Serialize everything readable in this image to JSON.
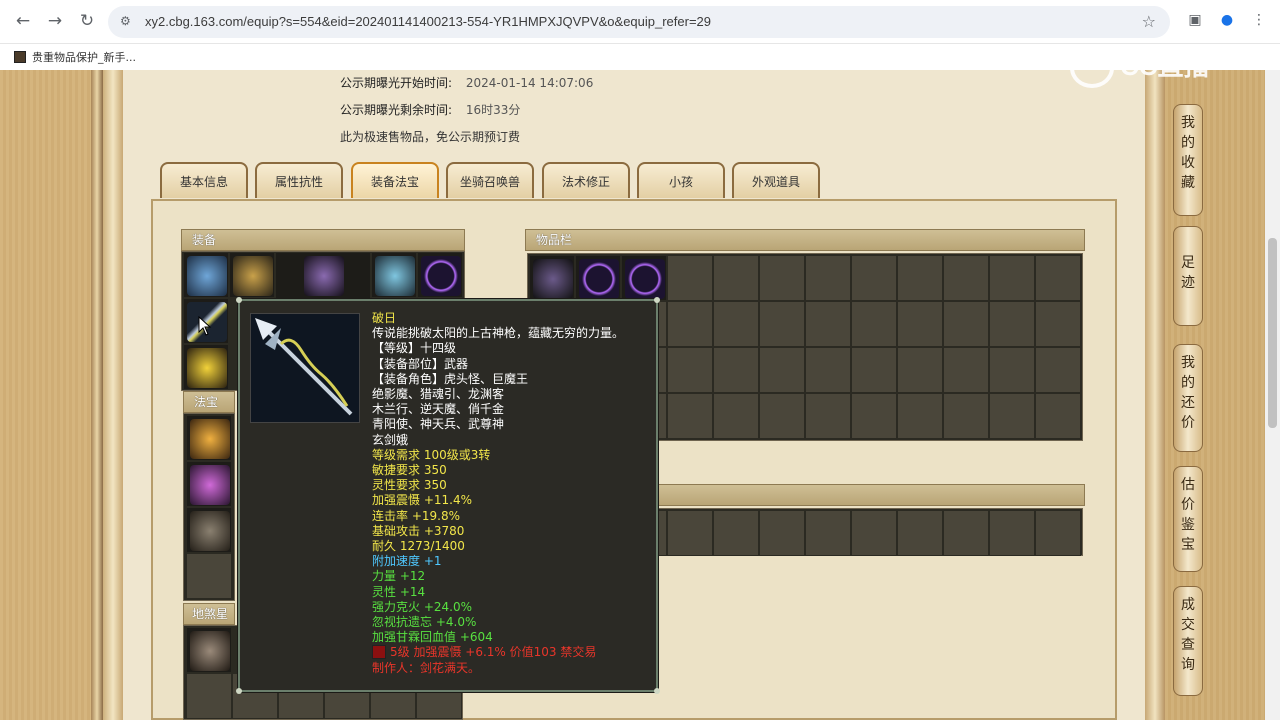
{
  "browser": {
    "url": "xy2.cbg.163.com/equip?s=554&eid=202401141400213-554-YR1HMPXJQVPV&o&equip_refer=29",
    "bookmark_label": "贵重物品保护_新手..."
  },
  "info": {
    "start_label": "公示期曝光开始时间:",
    "start_value": "2024-01-14 14:07:06",
    "remain_label": "公示期曝光剩余时间:",
    "remain_value": "16时33分",
    "note": "此为极速售物品，免公示期预订费"
  },
  "tabs": [
    "基本信息",
    "属性抗性",
    "装备法宝",
    "坐骑召唤兽",
    "法术修正",
    "小孩",
    "外观道具"
  ],
  "panels": {
    "equip": "装备",
    "fabao": "法宝",
    "dishaxing": "地煞星阵",
    "inventory": "物品栏"
  },
  "right_nav": [
    "我的收藏",
    "足迹",
    "我的还价",
    "估价鉴宝",
    "成交查询"
  ],
  "watermark": "CC直播",
  "tooltip": {
    "lines": [
      {
        "text": "破日",
        "color": "#f2e64a"
      },
      {
        "text": "传说能挑破太阳的上古神枪，蕴藏无穷的力量。",
        "color": "#ffffff"
      },
      {
        "text": "【等级】十四级",
        "color": "#ffffff"
      },
      {
        "text": "【装备部位】武器",
        "color": "#ffffff"
      },
      {
        "text": "【装备角色】虎头怪、巨魔王",
        "color": "#ffffff"
      },
      {
        "text": "绝影魔、猎魂引、龙渊客",
        "color": "#ffffff"
      },
      {
        "text": "木兰行、逆天魔、俏千金",
        "color": "#ffffff"
      },
      {
        "text": "青阳使、神天兵、武尊神",
        "color": "#ffffff"
      },
      {
        "text": "玄剑娥",
        "color": "#ffffff"
      },
      {
        "text": "等级需求 100级或3转",
        "color": "#f2e64a"
      },
      {
        "text": "敏捷要求 350",
        "color": "#f2e64a"
      },
      {
        "text": "灵性要求 350",
        "color": "#f2e64a"
      },
      {
        "text": "加强震慑 +11.4%",
        "color": "#f2e64a"
      },
      {
        "text": "连击率 +19.8%",
        "color": "#f2e64a"
      },
      {
        "text": "基础攻击 +3780",
        "color": "#f2e64a"
      },
      {
        "text": "耐久 1273/1400",
        "color": "#f2e64a"
      },
      {
        "text": "附加速度 +1",
        "color": "#4fc8ff"
      },
      {
        "text": "力量 +12",
        "color": "#58e040"
      },
      {
        "text": "灵性 +14",
        "color": "#58e040"
      },
      {
        "text": "强力克火 +24.0%",
        "color": "#58e040"
      },
      {
        "text": "忽视抗遗忘 +4.0%",
        "color": "#58e040"
      },
      {
        "text": "加强甘霖回血值 +604",
        "color": "#58e040"
      },
      {
        "text": "5级 加强震慑 +6.1% 价值103 禁交易",
        "color": "#e8352a"
      },
      {
        "text": "制作人：剑花满天。",
        "color": "#e8352a"
      }
    ]
  }
}
